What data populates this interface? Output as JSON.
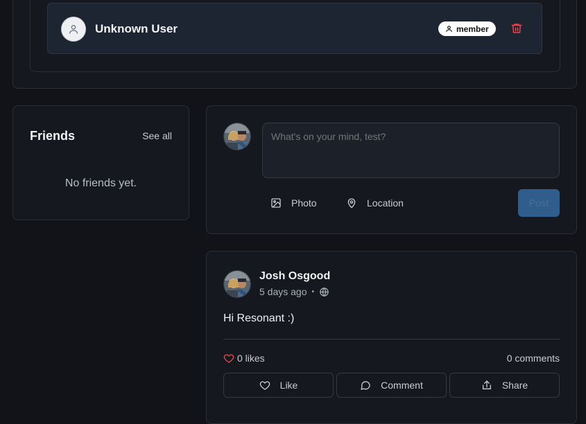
{
  "member": {
    "name": "Unknown User",
    "role": "member",
    "icons": {
      "avatar": "user-icon",
      "role": "user-icon",
      "delete": "trash-icon"
    },
    "delete_color": "#e5484d"
  },
  "friends": {
    "title": "Friends",
    "see_all": "See all",
    "empty": "No friends yet."
  },
  "composer": {
    "placeholder": "What's on your mind, test?",
    "photo_label": "Photo",
    "location_label": "Location",
    "post_label": "Post"
  },
  "post": {
    "author": "Josh Osgood",
    "time": "5 days ago",
    "separator": "•",
    "text": "Hi Resonant :)",
    "likes": "0 likes",
    "comments": "0 comments",
    "actions": {
      "like": "Like",
      "comment": "Comment",
      "share": "Share"
    },
    "visibility_icon": "globe-icon",
    "like_icon_color": "#e5484d"
  },
  "colors": {
    "background": "#111318",
    "panel": "#15181f",
    "member_card": "#1d2432",
    "post_button": "#2f5e8c"
  }
}
